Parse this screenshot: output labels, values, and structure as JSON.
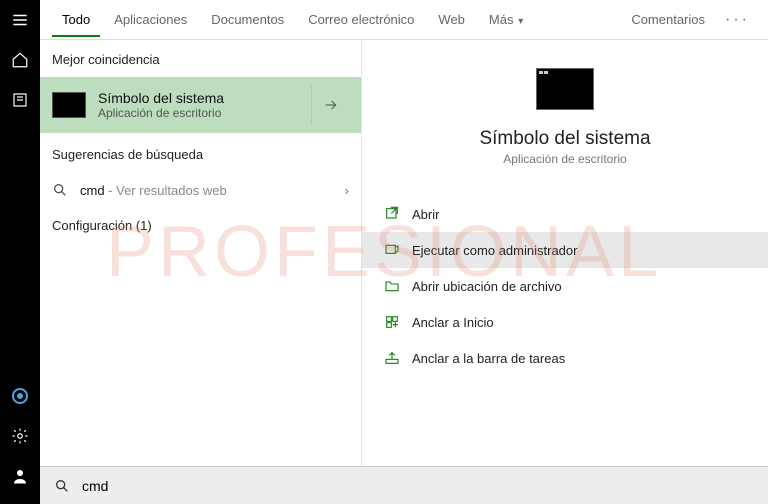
{
  "filters": {
    "todo": "Todo",
    "aplicaciones": "Aplicaciones",
    "documentos": "Documentos",
    "correo": "Correo electrónico",
    "web": "Web",
    "mas": "Más",
    "comentarios": "Comentarios"
  },
  "left": {
    "bestMatchLabel": "Mejor coincidencia",
    "bestMatch": {
      "title": "Símbolo del sistema",
      "subtitle": "Aplicación de escritorio"
    },
    "suggLabel": "Sugerencias de búsqueda",
    "sugg": {
      "query": "cmd",
      "hint": " - Ver resultados web"
    },
    "configLabel": "Configuración (1)"
  },
  "right": {
    "title": "Símbolo del sistema",
    "subtitle": "Aplicación de escritorio",
    "actions": {
      "open": "Abrir",
      "runAdmin": "Ejecutar como administrador",
      "openLoc": "Abrir ubicación de archivo",
      "pinStart": "Anclar a Inicio",
      "pinTask": "Anclar a la barra de tareas"
    }
  },
  "search": {
    "value": "cmd"
  },
  "watermark": "PROFESIONAL"
}
